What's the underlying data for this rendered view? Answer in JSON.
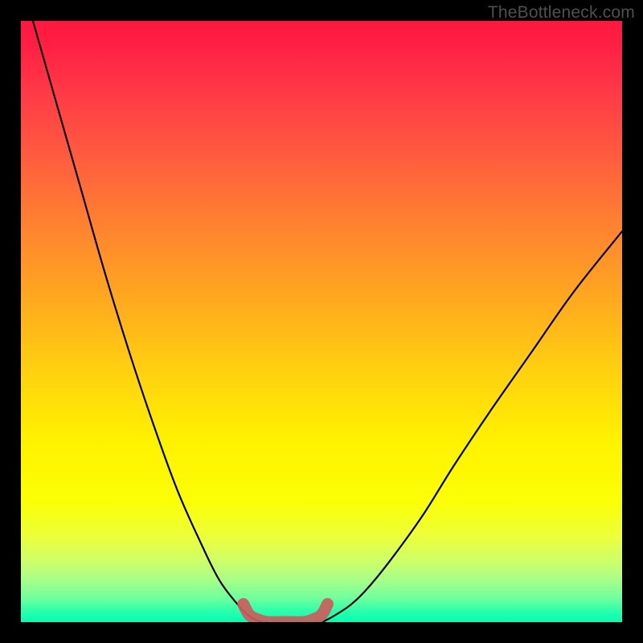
{
  "watermark": "TheBottleneck.com",
  "chart_data": {
    "type": "line",
    "title": "",
    "xlabel": "",
    "ylabel": "",
    "xlim": [
      0,
      100
    ],
    "ylim": [
      0,
      100
    ],
    "grid": false,
    "legend": false,
    "series": [
      {
        "name": "left-curve",
        "color": "#000000",
        "x": [
          2,
          6,
          10,
          14,
          18,
          22,
          26,
          30,
          33,
          36,
          38,
          40,
          41
        ],
        "y": [
          100,
          86,
          72,
          58,
          45,
          33,
          22,
          13,
          7,
          3,
          1,
          0,
          0
        ]
      },
      {
        "name": "right-curve",
        "color": "#000000",
        "x": [
          49,
          50,
          52,
          55,
          58,
          62,
          67,
          72,
          78,
          85,
          92,
          100
        ],
        "y": [
          0,
          0,
          1,
          3,
          6,
          11,
          18,
          26,
          35,
          45,
          55,
          65
        ]
      },
      {
        "name": "valley-highlight",
        "color": "#cd5c5c",
        "x": [
          37,
          38,
          39.5,
          41,
          44,
          47,
          48.5,
          50,
          51
        ],
        "y": [
          3,
          1.2,
          0.4,
          0,
          0,
          0,
          0.4,
          1.2,
          3
        ]
      }
    ],
    "background_gradient": {
      "direction": "top-to-bottom",
      "stops": [
        {
          "pos": 0,
          "color": "#ff173f"
        },
        {
          "pos": 12,
          "color": "#ff3a47"
        },
        {
          "pos": 34,
          "color": "#ff8230"
        },
        {
          "pos": 58,
          "color": "#ffd010"
        },
        {
          "pos": 80,
          "color": "#fbff05"
        },
        {
          "pos": 93,
          "color": "#a6ff88"
        },
        {
          "pos": 100,
          "color": "#00ffb4"
        }
      ]
    }
  }
}
